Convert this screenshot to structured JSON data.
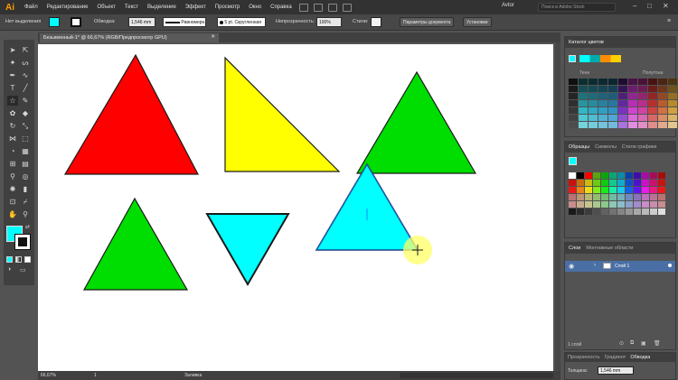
{
  "menubar": {
    "logo": "Ai",
    "items": [
      "Файл",
      "Редактирование",
      "Объект",
      "Текст",
      "Выделение",
      "Эффект",
      "Просмотр",
      "Окно",
      "Справка"
    ],
    "workspace": "Avtor",
    "search_placeholder": "Поиск в Adobe Stock"
  },
  "controlbar": {
    "selection_state": "Нет выделения",
    "stroke_label": "Обводка:",
    "stroke_value": "1,546 mm",
    "stroke_profile": "Равномерн.",
    "brush": "5 pt. Скругленная",
    "opacity_label": "Непрозрачность:",
    "opacity_value": "100%",
    "styles_label": "Стили:",
    "doc_setup_button": "Параметры документа",
    "prefs_button": "Установки"
  },
  "document": {
    "tab_title": "Безымянный-1* @ 66,67% (RGB/Предпросмотр GPU)"
  },
  "statusbar": {
    "zoom": "66,67%",
    "artboard": "1",
    "tool_name": "Заливка"
  },
  "colors": {
    "red": "#ff0000",
    "yellow": "#ffff00",
    "green": "#00dd00",
    "cyan": "#00ffff",
    "app_bg": "#535353",
    "selection_blue": "#4a6fa5",
    "cursor_highlight": "#ffff66"
  },
  "panels": {
    "color_guide": {
      "title": "Каталог цветов",
      "tabs": [
        "Тени",
        "Полутона"
      ]
    },
    "swatches": {
      "tabs": [
        "Образцы",
        "Символы",
        "Стили графики"
      ]
    },
    "layers": {
      "tabs": [
        "Слои",
        "Монтажные области"
      ],
      "layer_name": "Слой 1",
      "footer": "1 слой"
    },
    "bottom": {
      "tabs": [
        "Прозрачность",
        "Градиент",
        "Обводка"
      ],
      "weight_label": "Толщина:",
      "weight_value": "1,546 mm"
    }
  },
  "tools": [
    "selection-tool",
    "direct-selection-tool",
    "magic-wand-tool",
    "lasso-tool",
    "pen-tool",
    "curvature-tool",
    "type-tool",
    "line-tool",
    "rectangle-tool",
    "paintbrush-tool",
    "shaper-tool",
    "pencil-tool",
    "eraser-tool",
    "rotate-tool",
    "scale-tool",
    "width-tool",
    "free-transform-tool",
    "shape-builder-tool",
    "perspective-grid-tool",
    "mesh-tool",
    "gradient-tool",
    "eyedropper-tool",
    "blend-tool",
    "symbol-sprayer-tool",
    "column-graph-tool",
    "artboard-tool",
    "slice-tool",
    "hand-tool",
    "zoom-tool"
  ]
}
